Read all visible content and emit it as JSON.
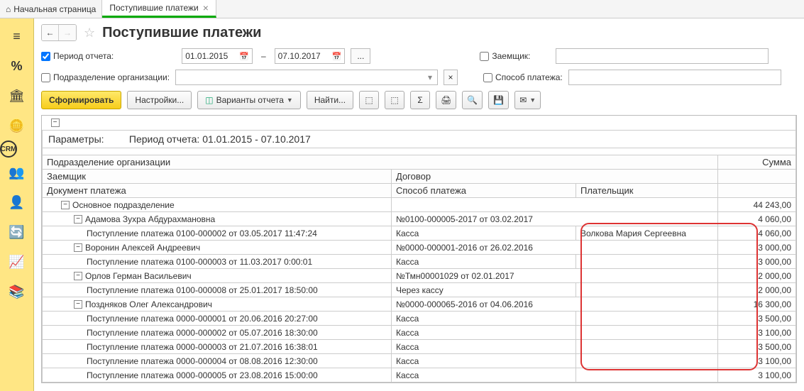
{
  "tabs": {
    "home": "Начальная страница",
    "active": "Поступившие платежи"
  },
  "title": "Поступившие платежи",
  "filters": {
    "period_label": "Период отчета:",
    "date_from": "01.01.2015",
    "date_to": "07.10.2017",
    "borrower_label": "Заемщик:",
    "org_label": "Подразделение организации:",
    "paymethod_label": "Способ платежа:"
  },
  "toolbar": {
    "generate": "Сформировать",
    "settings": "Настройки...",
    "variants": "Варианты отчета",
    "find": "Найти..."
  },
  "params": {
    "label": "Параметры:",
    "value": "Период отчета: 01.01.2015 - 07.10.2017"
  },
  "headers": {
    "org": "Подразделение организации",
    "sum": "Сумма",
    "borrower": "Заемщик",
    "contract": "Договор",
    "doc": "Документ платежа",
    "method": "Способ платежа",
    "payer": "Плательщик"
  },
  "rows": [
    {
      "lvl": 0,
      "toggle": "-",
      "c1": "Основное подразделение",
      "c2": "",
      "c3": "",
      "sum": "44 243,00"
    },
    {
      "lvl": 1,
      "toggle": "-",
      "c1": "Адамова Зухра Абдурахмановна",
      "c2": "№0100-000005-2017 от 03.02.2017",
      "c3": "",
      "sum": "4 060,00"
    },
    {
      "lvl": 2,
      "toggle": "",
      "c1": "Поступление платежа 0100-000002 от 03.05.2017 11:47:24",
      "c2": "Касса",
      "c3": "Волкова Мария Сергеевна",
      "sum": "4 060,00"
    },
    {
      "lvl": 1,
      "toggle": "-",
      "c1": "Воронин Алексей Андреевич",
      "c2": "№0000-000001-2016 от 26.02.2016",
      "c3": "",
      "sum": "3 000,00"
    },
    {
      "lvl": 2,
      "toggle": "",
      "c1": "Поступление платежа 0100-000003 от 11.03.2017 0:00:01",
      "c2": "Касса",
      "c3": "",
      "sum": "3 000,00"
    },
    {
      "lvl": 1,
      "toggle": "-",
      "c1": "Орлов Герман Васильевич",
      "c2": "№Тмн00001029 от 02.01.2017",
      "c3": "",
      "sum": "2 000,00"
    },
    {
      "lvl": 2,
      "toggle": "",
      "c1": "Поступление платежа 0100-000008 от 25.01.2017 18:50:00",
      "c2": "Через кассу",
      "c3": "",
      "sum": "2 000,00"
    },
    {
      "lvl": 1,
      "toggle": "-",
      "c1": "Поздняков Олег Александрович",
      "c2": "№0000-000065-2016 от 04.06.2016",
      "c3": "",
      "sum": "16 300,00"
    },
    {
      "lvl": 2,
      "toggle": "",
      "c1": "Поступление платежа 0000-000001 от 20.06.2016 20:27:00",
      "c2": "Касса",
      "c3": "",
      "sum": "3 500,00"
    },
    {
      "lvl": 2,
      "toggle": "",
      "c1": "Поступление платежа 0000-000002 от 05.07.2016 18:30:00",
      "c2": "Касса",
      "c3": "",
      "sum": "3 100,00"
    },
    {
      "lvl": 2,
      "toggle": "",
      "c1": "Поступление платежа 0000-000003 от 21.07.2016 16:38:01",
      "c2": "Касса",
      "c3": "",
      "sum": "3 500,00"
    },
    {
      "lvl": 2,
      "toggle": "",
      "c1": "Поступление платежа 0000-000004 от 08.08.2016 12:30:00",
      "c2": "Касса",
      "c3": "",
      "sum": "3 100,00"
    },
    {
      "lvl": 2,
      "toggle": "",
      "c1": "Поступление платежа 0000-000005 от 23.08.2016 15:00:00",
      "c2": "Касса",
      "c3": "",
      "sum": "3 100,00"
    }
  ]
}
